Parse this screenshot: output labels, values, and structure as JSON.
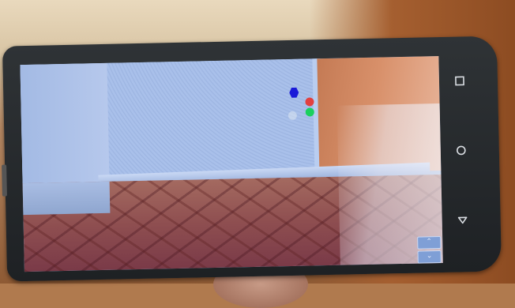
{
  "scene": {
    "description_colors": {
      "wall": "#a7bde6",
      "door": "#d8906a",
      "floor": "#8e4e50"
    }
  },
  "ar_markers": [
    {
      "name": "blue",
      "color": "#1a1ad8"
    },
    {
      "name": "red",
      "color": "#e2403f"
    },
    {
      "name": "green",
      "color": "#1bd05e"
    },
    {
      "name": "grey",
      "color": "#dce6f0"
    }
  ],
  "screen_controls": {
    "up_icon": "chevron-up-icon",
    "down_icon": "chevron-down-icon",
    "up_glyph": "⌃",
    "down_glyph": "⌄"
  },
  "nav_bar": {
    "recent_icon": "square-icon",
    "home_icon": "circle-icon",
    "back_icon": "triangle-back-icon"
  }
}
